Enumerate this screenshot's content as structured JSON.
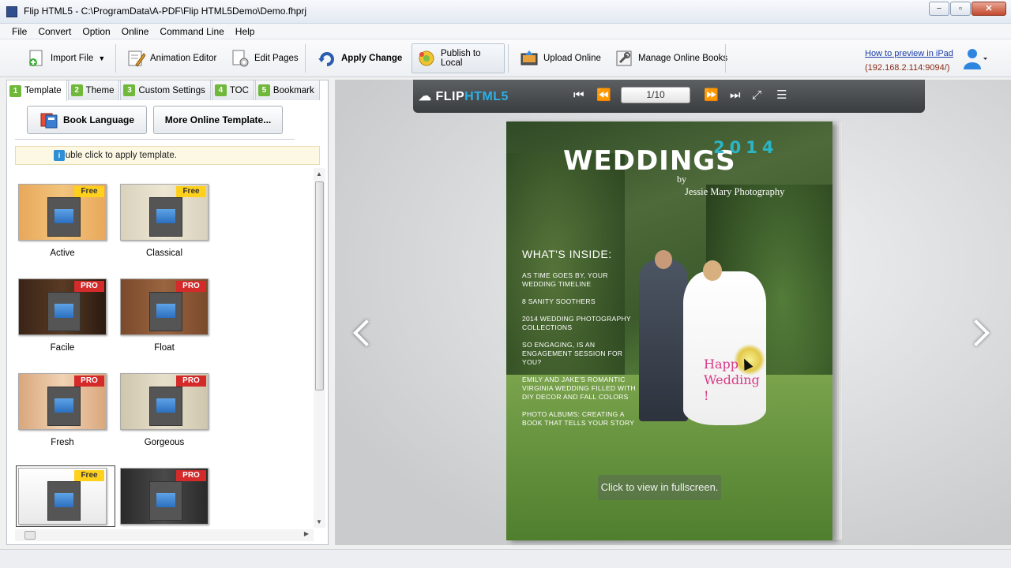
{
  "window": {
    "title": "Flip HTML5 - C:\\ProgramData\\A-PDF\\Flip HTML5Demo\\Demo.fhprj",
    "minimize": "−",
    "restore": "▫",
    "close": "✕"
  },
  "menu": [
    "File",
    "Convert",
    "Option",
    "Online",
    "Command Line",
    "Help"
  ],
  "toolbar": {
    "import_file": "Import File",
    "animation_editor": "Animation Editor",
    "edit_pages": "Edit Pages",
    "apply_change": "Apply Change",
    "publish_to_local": "Publish to Local",
    "upload_online": "Upload Online",
    "manage_online_books": "Manage Online Books",
    "preview_link": "How to preview in iPad",
    "ip_address": "(192.168.2.114:9094/)"
  },
  "tabs": [
    {
      "num": "1",
      "label": "Template"
    },
    {
      "num": "2",
      "label": "Theme"
    },
    {
      "num": "3",
      "label": "Custom Settings"
    },
    {
      "num": "4",
      "label": "TOC"
    },
    {
      "num": "5",
      "label": "Bookmark"
    }
  ],
  "panel": {
    "book_language": "Book Language",
    "more_templates": "More Online Template...",
    "hint": "Double click to apply template."
  },
  "templates": [
    {
      "name": "Active",
      "badge": "Free"
    },
    {
      "name": "Classical",
      "badge": "Free"
    },
    {
      "name": "Facile",
      "badge": "PRO"
    },
    {
      "name": "Float",
      "badge": "PRO"
    },
    {
      "name": "Fresh",
      "badge": "PRO"
    },
    {
      "name": "Gorgeous",
      "badge": "PRO"
    },
    {
      "name": "",
      "badge": "Free"
    },
    {
      "name": "",
      "badge": "PRO"
    }
  ],
  "viewer": {
    "brand_flip": "FLIP",
    "brand_html5": "HTML5",
    "page_indicator": "1/10",
    "fullscreen_tip": "Click to view in fullscreen."
  },
  "magazine": {
    "title": "WEDDINGS",
    "year": "2014",
    "by": "by",
    "photographer": "Jessie Mary Photography",
    "inside_title": "WHAT'S INSIDE:",
    "items": [
      "As time goes by, your wedding timeline",
      "8 sanity soothers",
      "2014 wedding photography collections",
      "So engaging, is an engagement session for you?",
      "Emily and Jake's romantic Virginia wedding filled with DIY decor and fall colors",
      "Photo albums: creating a book that tells your story"
    ],
    "happy_line1": "Happ",
    "happy_line2": "Wedding",
    "happy_line3": "!"
  }
}
